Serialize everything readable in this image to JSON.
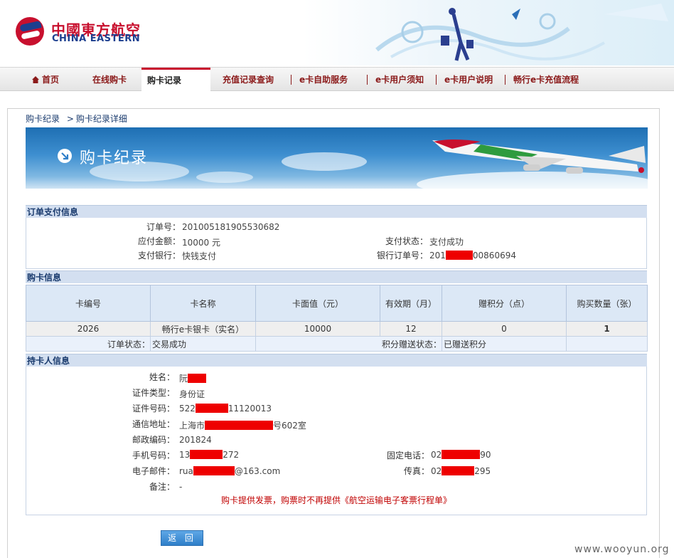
{
  "brand": {
    "name_cn": "中國東方航空",
    "name_en": "CHINA EASTERN"
  },
  "nav": {
    "items": [
      {
        "label": "首页",
        "icon": "home-icon"
      },
      {
        "label": "在线购卡"
      },
      {
        "label": "购卡记录",
        "active": true
      },
      {
        "label": "充值记录查询"
      },
      {
        "label": "e卡自助服务"
      },
      {
        "label": "e卡用户须知"
      },
      {
        "label": "e卡用户说明"
      },
      {
        "label": "畅行e卡充值流程"
      }
    ]
  },
  "breadcrumb": {
    "root": "购卡纪录",
    "sep": ">",
    "current": "购卡纪录详细"
  },
  "hero": {
    "title": "购卡纪录"
  },
  "order": {
    "section_title": "订单支付信息",
    "order_no_label": "订单号：",
    "order_no": "201005181905530682",
    "amount_label": "应付金额：",
    "amount": "10000 元",
    "bank_label": "支付银行：",
    "bank": "快钱支付",
    "pay_status_label": "支付状态：",
    "pay_status": "支付成功",
    "bank_order_label": "银行订单号：",
    "bank_order_prefix": "201",
    "bank_order_suffix": "00860694"
  },
  "cards": {
    "section_title": "购卡信息",
    "headers": [
      "卡编号",
      "卡名称",
      "卡面值（元）",
      "有效期（月）",
      "赠积分（点）",
      "购买数量（张）"
    ],
    "row": [
      "2026",
      "畅行e卡银卡（实名）",
      "10000",
      "12",
      "0",
      "1"
    ],
    "order_status_label": "订单状态：",
    "order_status": "交易成功",
    "points_status_label": "积分赠送状态：",
    "points_status": "已赠送积分"
  },
  "holder": {
    "section_title": "持卡人信息",
    "name_label": "姓名：",
    "name_prefix": "阮",
    "id_type_label": "证件类型：",
    "id_type": "身份证",
    "id_no_label": "证件号码：",
    "id_no_prefix": "522",
    "id_no_suffix": "11120013",
    "address_label": "通信地址：",
    "address_prefix": "上海市",
    "address_suffix": "号602室",
    "zip_label": "邮政编码：",
    "zip": "201824",
    "mobile_label": "手机号码：",
    "mobile_prefix": "13",
    "mobile_suffix": "272",
    "email_label": "电子邮件：",
    "email_prefix": "rua",
    "email_suffix": "@163.com",
    "remark_label": "备注：",
    "remark": "-",
    "phone_label": "固定电话：",
    "phone_prefix": "02",
    "phone_suffix": "90",
    "fax_label": "传真：",
    "fax_prefix": "02",
    "fax_suffix": "295"
  },
  "note": "购卡提供发票，购票时不再提供《航空运输电子客票行程单》",
  "back_button": "返  回",
  "watermark": "www.wooyun.org"
}
